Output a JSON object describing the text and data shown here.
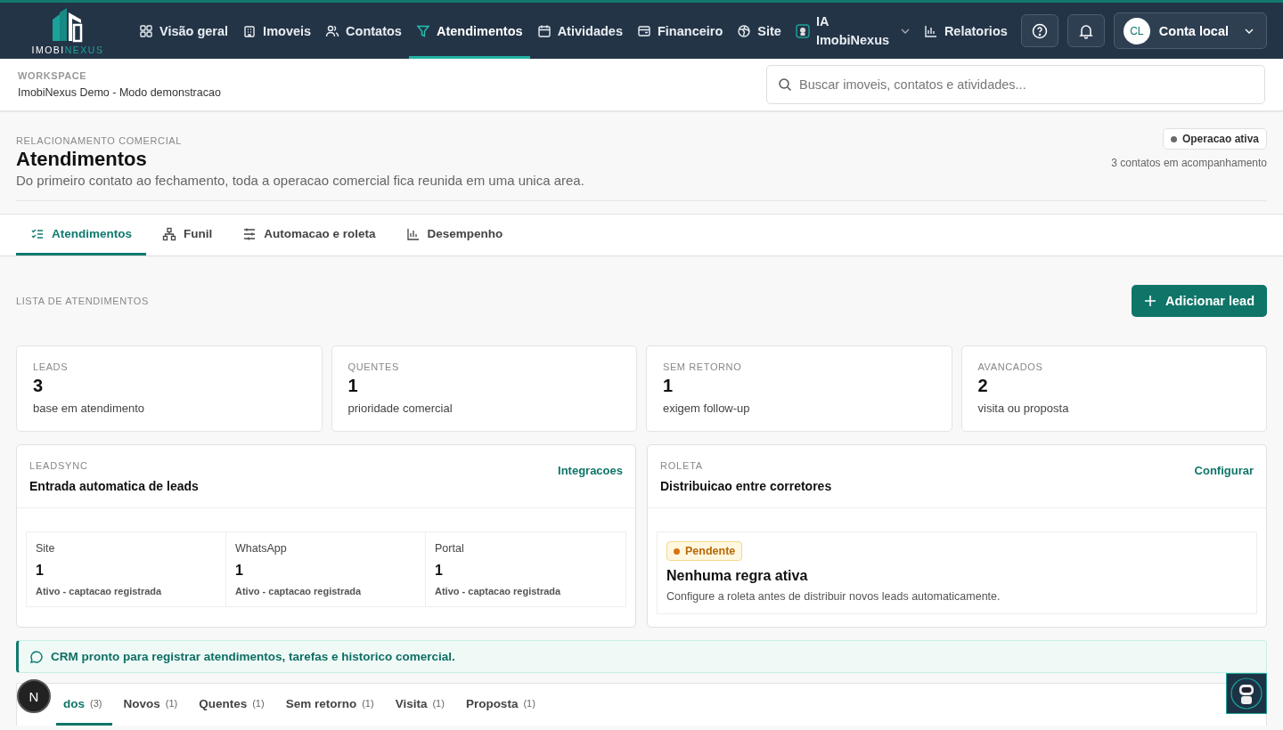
{
  "logo": {
    "primary": "IMOBI",
    "accent": "NEXUS"
  },
  "nav": [
    {
      "label": "Visão geral",
      "selected": false
    },
    {
      "label": "Imoveis",
      "selected": false
    },
    {
      "label": "Contatos",
      "selected": false
    },
    {
      "label": "Atendimentos",
      "selected": true
    },
    {
      "label": "Atividades",
      "selected": false
    },
    {
      "label": "Financeiro",
      "selected": false
    },
    {
      "label": "Site",
      "selected": false
    },
    {
      "label": "IA ImobiNexus",
      "selected": false
    },
    {
      "label": "Relatorios",
      "selected": false
    }
  ],
  "account": {
    "initials": "CL",
    "name": "Conta local"
  },
  "workspace": {
    "label": "WORKSPACE",
    "name": "ImobiNexus Demo - Modo demonstracao"
  },
  "search": {
    "placeholder": "Buscar imoveis, contatos e atividades..."
  },
  "page": {
    "eyebrow": "RELACIONAMENTO COMERCIAL",
    "title": "Atendimentos",
    "subtitle": "Do primeiro contato ao fechamento, toda a operacao comercial fica reunida em uma unica area.",
    "status": {
      "label": "Operacao ativa",
      "color": "#6b6b6b"
    },
    "summary": "3 contatos em acompanhamento"
  },
  "tabs": [
    {
      "label": "Atendimentos",
      "selected": true
    },
    {
      "label": "Funil",
      "selected": false
    },
    {
      "label": "Automacao e roleta",
      "selected": false
    },
    {
      "label": "Desempenho",
      "selected": false
    }
  ],
  "list": {
    "title": "LISTA DE ATENDIMENTOS",
    "add_button": "Adicionar lead"
  },
  "stats": [
    {
      "label": "LEADS",
      "value": "3",
      "caption": "base em atendimento"
    },
    {
      "label": "QUENTES",
      "value": "1",
      "caption": "prioridade comercial"
    },
    {
      "label": "SEM RETORNO",
      "value": "1",
      "caption": "exigem follow-up"
    },
    {
      "label": "AVANCADOS",
      "value": "2",
      "caption": "visita ou proposta"
    }
  ],
  "leadsync": {
    "eyebrow": "LEADSYNC",
    "title": "Entrada automatica de leads",
    "link": "Integracoes",
    "channels": [
      {
        "name": "Site",
        "count": "1",
        "status": "Ativo - captacao registrada"
      },
      {
        "name": "WhatsApp",
        "count": "1",
        "status": "Ativo - captacao registrada"
      },
      {
        "name": "Portal",
        "count": "1",
        "status": "Ativo - captacao registrada"
      }
    ]
  },
  "roleta": {
    "eyebrow": "ROLETA",
    "title": "Distribuicao entre corretores",
    "link": "Configurar",
    "badge": {
      "label": "Pendente",
      "color": "#d9730d"
    },
    "rule_title": "Nenhuma regra ativa",
    "rule_text": "Configure a roleta antes de distribuir novos leads automaticamente."
  },
  "alert": "CRM pronto para registrar atendimentos, tarefas e historico comercial.",
  "filters": [
    {
      "label": "dos",
      "count": "(3)",
      "selected": true
    },
    {
      "label": "Novos",
      "count": "(1)",
      "selected": false
    },
    {
      "label": "Quentes",
      "count": "(1)",
      "selected": false
    },
    {
      "label": "Sem retorno",
      "count": "(1)",
      "selected": false
    },
    {
      "label": "Visita",
      "count": "(1)",
      "selected": false
    },
    {
      "label": "Proposta",
      "count": "(1)",
      "selected": false
    }
  ],
  "floating_badge": "N"
}
